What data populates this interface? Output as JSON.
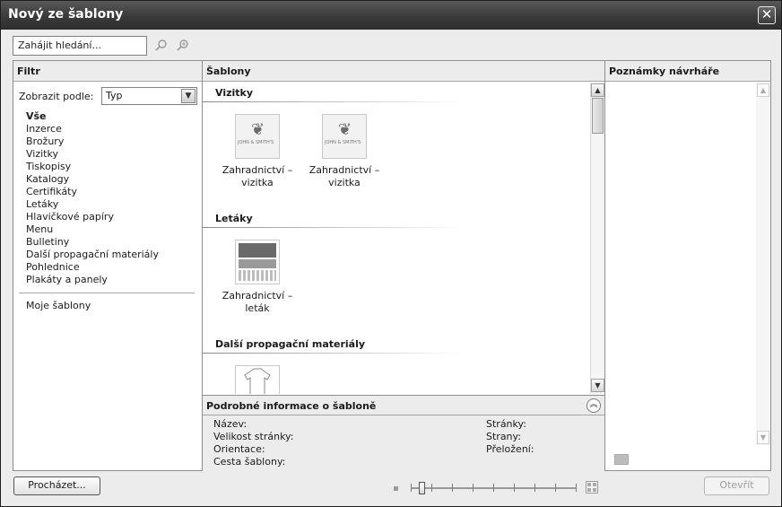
{
  "window": {
    "title": "Nový ze šablony",
    "close_glyph": "✕"
  },
  "search": {
    "placeholder": "Zahájit hledání..."
  },
  "filter": {
    "header": "Filtr",
    "show_by_label": "Zobrazit podle:",
    "show_by_value": "Typ",
    "categories": [
      "Vše",
      "Inzerce",
      "Brožury",
      "Vizitky",
      "Tiskopisy",
      "Katalogy",
      "Certifikáty",
      "Letáky",
      "Hlavičkové papíry",
      "Menu",
      "Bulletiny",
      "Další propagační materiály",
      "Pohlednice",
      "Plakáty a panely"
    ],
    "my_templates": "Moje šablony"
  },
  "templates": {
    "header": "Šablony",
    "groups": [
      {
        "name": "Vizitky",
        "items": [
          {
            "line1": "Zahradnictví –",
            "line2": "vizitka",
            "thumb_text": "JOHN & SMITH'S"
          },
          {
            "line1": "Zahradnictví –",
            "line2": "vizitka",
            "thumb_text": "JOHN & SMITH'S"
          }
        ]
      },
      {
        "name": "Letáky",
        "items": [
          {
            "line1": "Zahradnictví –",
            "line2": "leták",
            "thumb_text": ""
          }
        ]
      },
      {
        "name": "Další propagační materiály",
        "items": []
      }
    ]
  },
  "details": {
    "header": "Podrobné informace o šabloně",
    "name_label": "Název:",
    "size_label": "Velikost stránky:",
    "orientation_label": "Orientace:",
    "path_label": "Cesta šablony:",
    "pages_label": "Stránky:",
    "sides_label": "Strany:",
    "fold_label": "Přeložení:"
  },
  "notes": {
    "header": "Poznámky návrháře"
  },
  "footer": {
    "browse_label": "Procházet...",
    "open_label": "Otevřít"
  },
  "zoom": {
    "level": 0.05
  }
}
